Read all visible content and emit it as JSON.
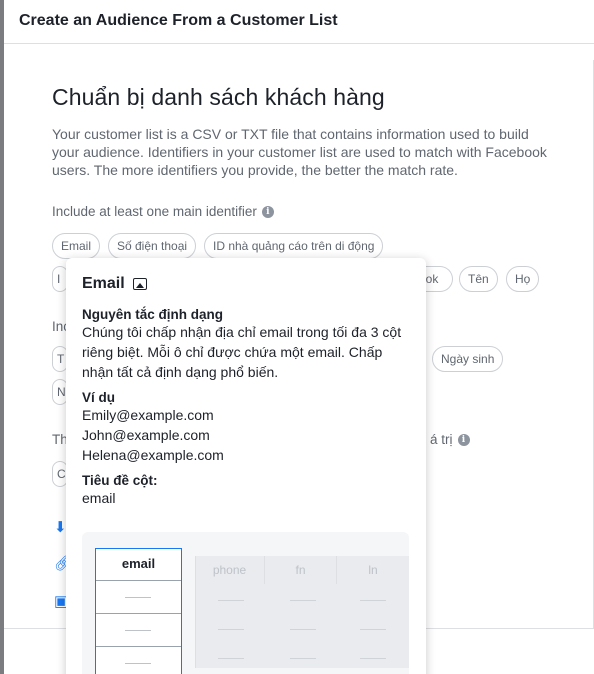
{
  "dialog": {
    "title": "Create an Audience From a Customer List"
  },
  "main": {
    "heading": "Chuẩn bị danh sách khách hàng",
    "description": "Your customer list is a CSV or TXT file that contains information used to build your audience. Identifiers in your customer list are used to match with Facebook users. The more identifiers you provide, the better the match rate.",
    "main_identifier_label": "Include at least one main identifier",
    "info_icon": "info-icon",
    "main_tags_row1": [
      "Email",
      "Số điện thoại",
      "ID nhà quảng cáo trên di động"
    ],
    "main_tags_row2_visible": [
      "ook",
      "Tên",
      "Họ"
    ],
    "secondary_label_partial": "Inc",
    "secondary_tag_visible": "Ngày sinh",
    "third_label_partial_left": "Th",
    "third_label_partial_right": "á trị"
  },
  "popover": {
    "title": "Email",
    "title_icon": "image-icon",
    "format_heading": "Nguyên tắc định dạng",
    "format_text": "Chúng tôi chấp nhận địa chỉ email trong tối đa 3 cột riêng biệt. Mỗi ô chỉ được chứa một email. Chấp nhận tất cả định dạng phổ biến.",
    "example_heading": "Ví dụ",
    "examples": [
      "Emily@example.com",
      "John@example.com",
      "Helena@example.com"
    ],
    "column_heading": "Tiêu đề cột:",
    "column_value": "email",
    "table_headers": [
      "email",
      "phone",
      "fn",
      "ln"
    ]
  },
  "colors": {
    "accent": "#1877f2",
    "text": "#1d2129",
    "muted": "#606770"
  }
}
